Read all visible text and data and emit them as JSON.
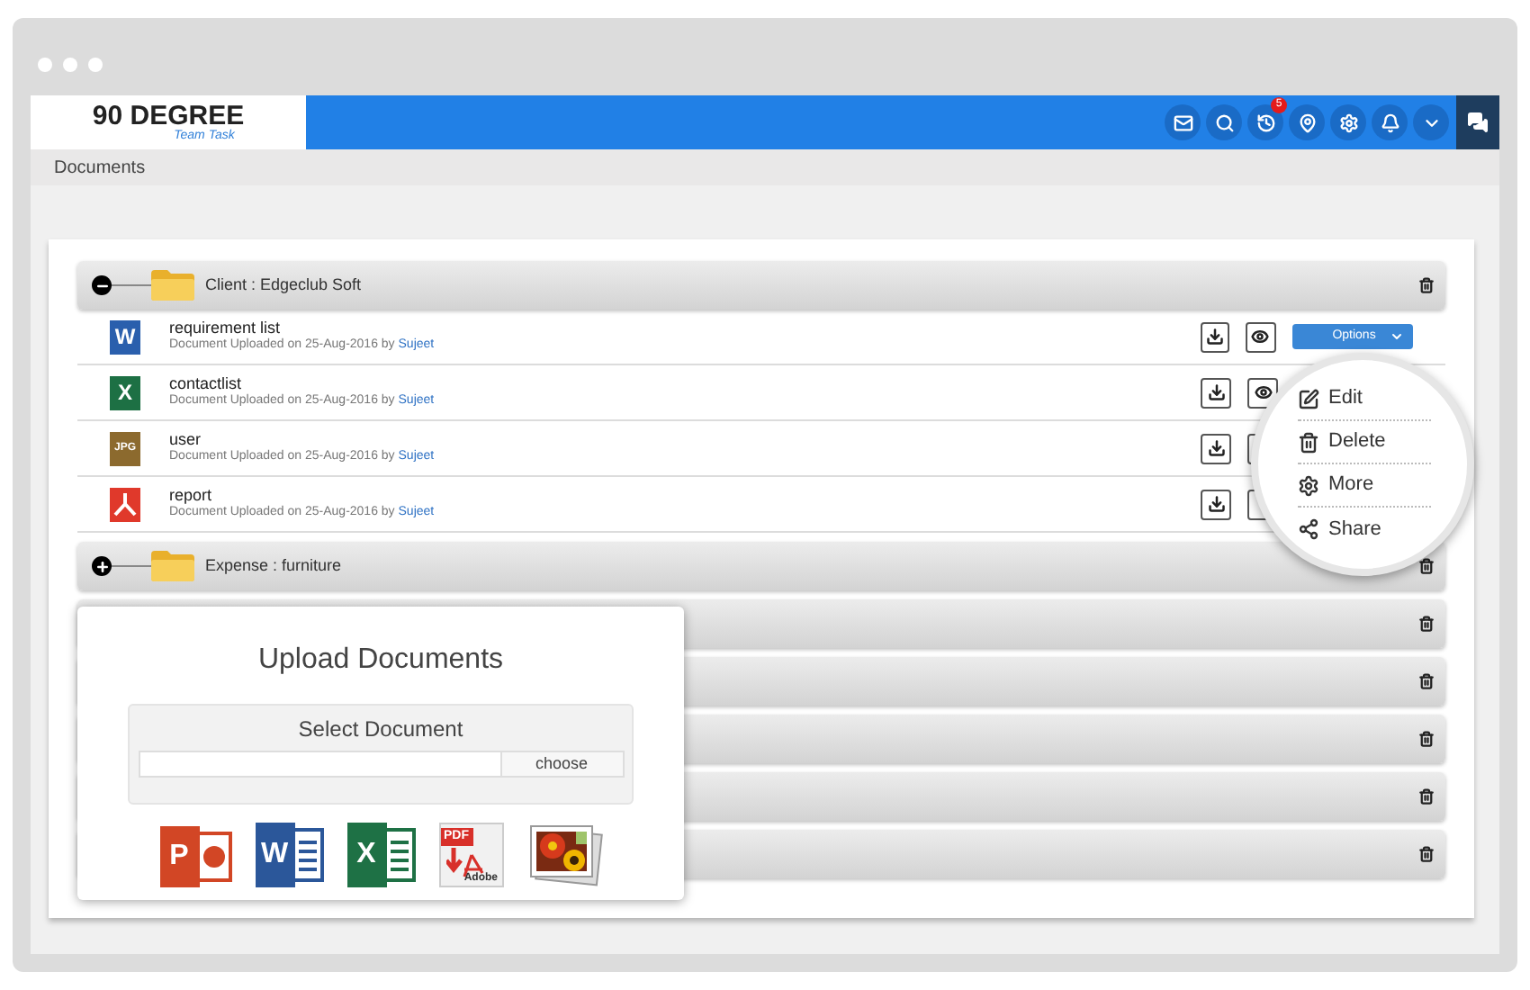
{
  "logo": {
    "title": "90 DEGREE",
    "subtitle": "Team Task"
  },
  "header_icons": [
    {
      "kind": "mail"
    },
    {
      "kind": "search"
    },
    {
      "kind": "history",
      "badge": "5"
    },
    {
      "kind": "pin"
    },
    {
      "kind": "settings"
    },
    {
      "kind": "bell"
    },
    {
      "kind": "caret"
    }
  ],
  "breadcrumb": "Documents",
  "folders": [
    {
      "kind": "folder",
      "label": "Client : Edgeclub Soft",
      "expanded": true,
      "files": [
        {
          "kind": "word",
          "badge": "W",
          "name": "requirement list",
          "meta": "Document Uploaded on 25-Aug-2016 by",
          "user": "Sujeet",
          "options": "Options"
        },
        {
          "kind": "excel",
          "badge": "X",
          "name": "contactlist",
          "meta": "Document Uploaded on 25-Aug-2016 by",
          "user": "Sujeet"
        },
        {
          "kind": "jpg",
          "badge": "JPG",
          "name": "user",
          "meta": "Document Uploaded on 25-Aug-2016 by",
          "user": "Sujeet"
        },
        {
          "kind": "pdf",
          "name": "report",
          "meta": "Document Uploaded on 25-Aug-2016 by",
          "user": "Sujeet"
        }
      ]
    },
    {
      "kind": "folder",
      "label": "Expense : furniture",
      "expanded": false
    },
    {
      "kind": "covered"
    },
    {
      "kind": "covered"
    },
    {
      "kind": "covered"
    },
    {
      "kind": "covered"
    },
    {
      "kind": "covered"
    }
  ],
  "options_menu": [
    {
      "kind": "edit",
      "label": "Edit"
    },
    {
      "kind": "delete",
      "label": "Delete"
    },
    {
      "kind": "more",
      "label": "More"
    },
    {
      "kind": "share",
      "label": "Share"
    }
  ],
  "upload": {
    "title": "Upload Documents",
    "select_label": "Select Document",
    "button": "choose",
    "formats": [
      {
        "kind": "powerpoint",
        "letter": "P"
      },
      {
        "kind": "word",
        "letter": "W"
      },
      {
        "kind": "excel",
        "letter": "X"
      },
      {
        "kind": "pdf",
        "letter": "PDF",
        "caption": "Adobe"
      },
      {
        "kind": "image"
      }
    ]
  }
}
